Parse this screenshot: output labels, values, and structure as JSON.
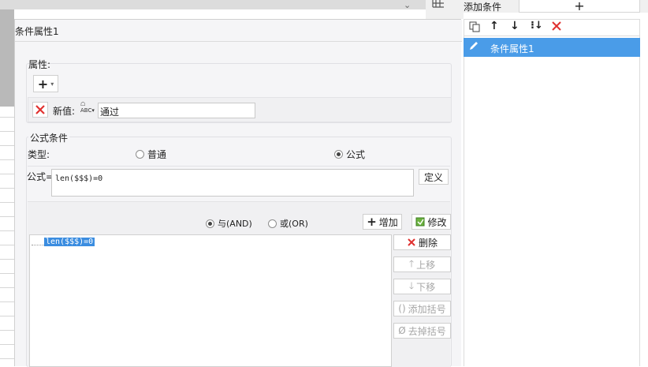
{
  "dialog": {
    "title": "条件属性1"
  },
  "properties": {
    "label": "属性:",
    "new_value_label": "新值:",
    "new_value": "通过"
  },
  "formula_condition": {
    "label": "公式条件",
    "type_label": "类型:",
    "option_normal": "普通",
    "option_formula": "公式",
    "selected_type": "公式",
    "formula_label": "公式=",
    "formula_value": "len($$$)=0",
    "define_button": "定义"
  },
  "logic": {
    "and_label": "与(AND)",
    "or_label": "或(OR)",
    "selected": "与(AND)",
    "add_button": "增加",
    "modify_button": "修改"
  },
  "conditions_list": {
    "items": [
      "len($$$)=0"
    ]
  },
  "side_buttons": {
    "delete": "删除",
    "move_up": "上移",
    "move_down": "下移",
    "add_parens": "添加括号",
    "remove_parens": "去掉括号"
  },
  "right_panel": {
    "add_condition_label": "添加条件",
    "items": [
      "条件属性1"
    ]
  },
  "colors": {
    "selection": "#4a9ce8",
    "highlight": "#3b8de0",
    "delete_red": "#e0312f"
  }
}
